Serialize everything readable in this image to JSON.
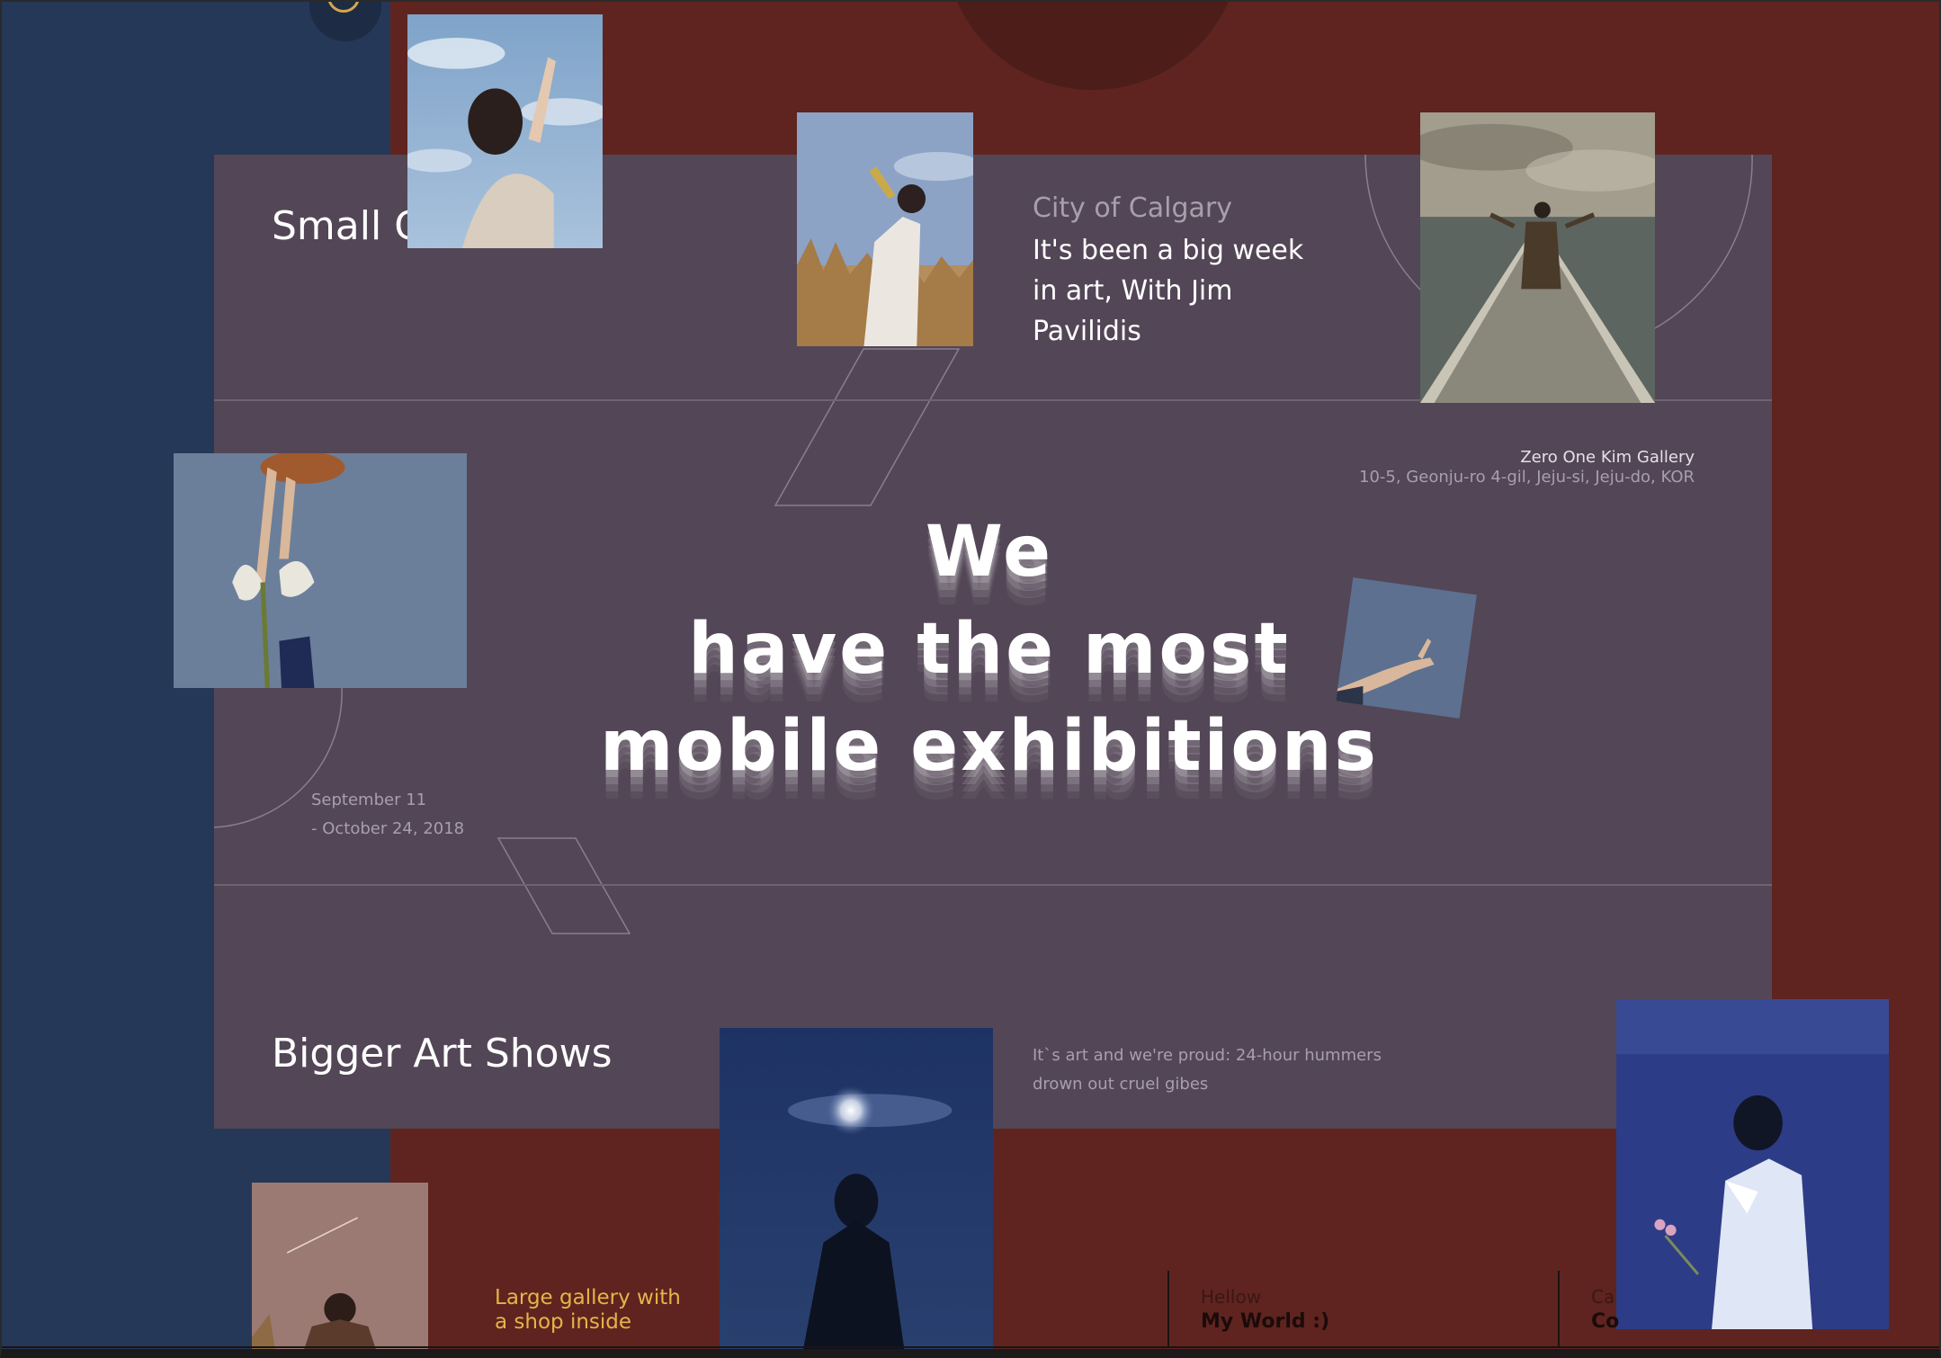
{
  "sections": {
    "small_title": "Small G",
    "bigger_title": "Bigger Art Shows"
  },
  "city": {
    "title": "City of Calgary",
    "body": "It's been a big week in art, With Jim Pavilidis"
  },
  "venue": {
    "name": "Zero One Kim Gallery",
    "address": "10-5, Geonju-ro 4-gil, Jeju-si, Jeju-do, KOR"
  },
  "dates": {
    "start": "September 11",
    "end": "- October 24, 2018"
  },
  "headline": {
    "line1": "We",
    "line2": "have the most",
    "line3": "mobile exhibitions"
  },
  "tagline": "It`s art and we're proud: 24-hour hummers drown out cruel gibes",
  "footer": {
    "gallery_line1": "Large gallery with",
    "gallery_line2": "a shop inside",
    "hello_label": "Hellow",
    "hello_value": "My World :)",
    "partial_label": "Ca",
    "partial_value": "Co"
  },
  "colors": {
    "page_background": "#5f241f",
    "navy_strip": "#263858",
    "panel": "#534656",
    "accent_gold": "#e6b44a"
  }
}
